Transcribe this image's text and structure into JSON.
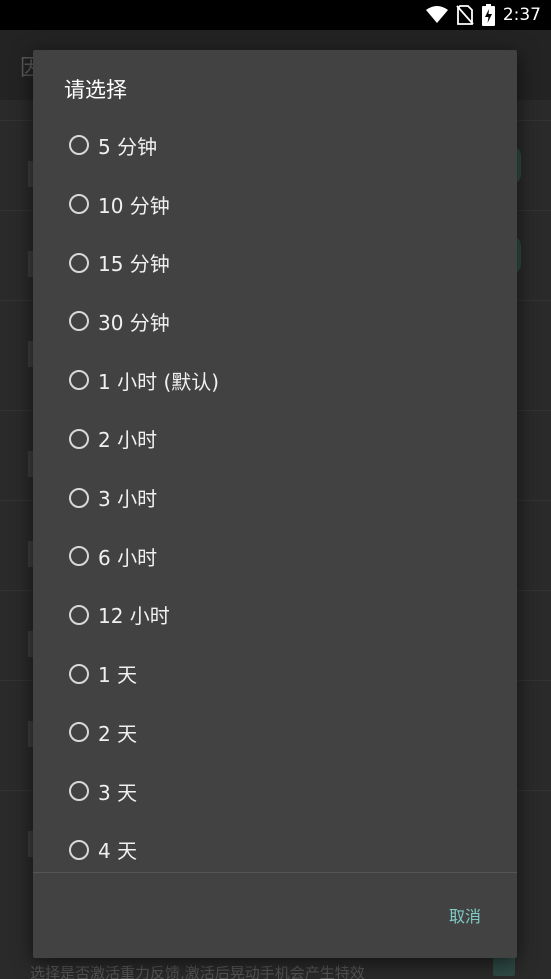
{
  "status_bar": {
    "time": "2:37",
    "icons": [
      "wifi-icon",
      "no-sim-icon",
      "battery-charging-icon"
    ]
  },
  "background": {
    "toolbar_title_fragment": "因",
    "bottom_text": "选择是否激活重力反馈,激活后晃动手机会产生特效"
  },
  "dialog": {
    "title": "请选择",
    "options": [
      {
        "label": "5 分钟"
      },
      {
        "label": "10 分钟"
      },
      {
        "label": "15 分钟"
      },
      {
        "label": "30 分钟"
      },
      {
        "label": "1 小时 (默认)"
      },
      {
        "label": "2 小时"
      },
      {
        "label": "3 小时"
      },
      {
        "label": "6 小时"
      },
      {
        "label": "12 小时"
      },
      {
        "label": "1 天"
      },
      {
        "label": "2 天"
      },
      {
        "label": "3 天"
      },
      {
        "label": "4 天"
      }
    ],
    "cancel_label": "取消",
    "accent_color": "#80cbc4",
    "background_color": "#424242"
  }
}
